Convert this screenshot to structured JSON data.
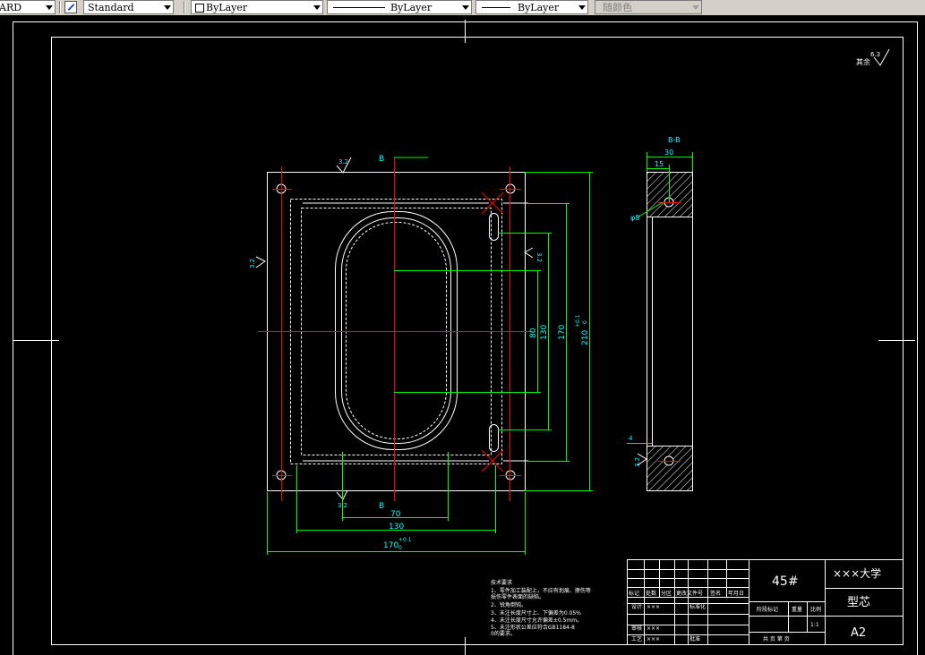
{
  "toolbar": {
    "textstyle_value": "ARD",
    "dimstyle_value": "Standard",
    "layer_value": "ByLayer",
    "linetype_value": "ByLayer",
    "lineweight_value": "ByLayer",
    "plotstyle_value": "随颜色"
  },
  "drawing": {
    "surface_symbol": "6.3",
    "surface_note": "其余",
    "section_marker": "B-B",
    "roughness_small": "3.2",
    "dims_horizontal": [
      "70",
      "130",
      "170",
      "15",
      "30",
      "4"
    ],
    "dims_vertical": [
      "80",
      "130",
      "170",
      "210"
    ],
    "tolerance_upper": "+0.1",
    "tolerance_lower": "0",
    "dia_label": "φ8",
    "b_mark": "B"
  },
  "notes": {
    "title": "技术要求",
    "lines": [
      "1、零件加工装配上，不应有划痕、擦伤等",
      "   损伤零件表面的缺陷。",
      "2、锐角倒钝。",
      "3、未注长度尺寸上、下偏差为0.05%",
      "4、未注长度尺寸允许偏差±0.5mm。",
      "5、未注形状公差应符合GB1184-8",
      "   0的要求。"
    ]
  },
  "title_block": {
    "material": "45#",
    "university": "×××大学",
    "part_name": "型芯",
    "sheet": "A2",
    "headers": [
      "标记",
      "处数",
      "分区",
      "更改文件号",
      "签名",
      "年月日"
    ],
    "design_label": "设计",
    "design_value": "×××",
    "standard_label": "标准化",
    "review_label": "审核",
    "review_value": "×××",
    "process_label": "工艺",
    "process_value": "×××",
    "approve_label": "批准",
    "stage_label": "阶段标记",
    "weight_label": "重量",
    "scale_label": "比例",
    "scale_value": "1:1",
    "sheets_label": "共  页  第  页"
  },
  "colors": {
    "background": "#000000",
    "line": "#ffffff",
    "center": "#ff0000",
    "dim": "#00ff00",
    "text": "#00ffff"
  }
}
